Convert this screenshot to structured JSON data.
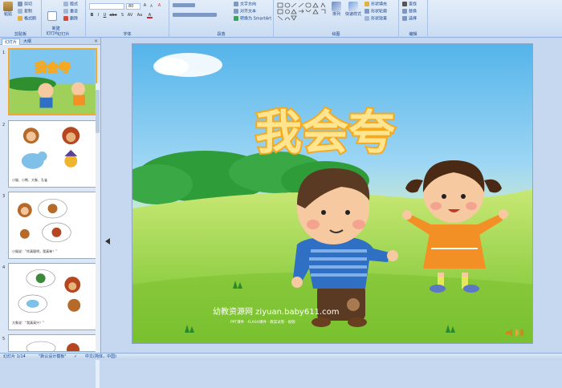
{
  "ribbon": {
    "clipboard": {
      "paste": "粘贴",
      "cut": "剪切",
      "copy": "复制",
      "format_painter": "格式刷",
      "title": "剪贴板"
    },
    "slides": {
      "new_slide": "新建\n幻灯片",
      "layout": "版式",
      "reset": "重设",
      "delete": "删除",
      "title": "幻灯片"
    },
    "font": {
      "font_name": "",
      "font_size": "80",
      "grow": "A",
      "shrink": "A",
      "clear": "A",
      "bold": "B",
      "italic": "I",
      "underline": "U",
      "strike": "abe",
      "shadow": "S",
      "spacing": "AV",
      "case": "Aa",
      "color": "A",
      "title": "字体"
    },
    "paragraph": {
      "text_direction": "文字方向",
      "align_text": "对齐文本",
      "smartart": "转换为 SmartArt",
      "title": "段落"
    },
    "drawing": {
      "arrange": "排列",
      "quick_styles": "快速样式",
      "fill": "形状填充",
      "outline": "形状轮廓",
      "effects": "形状效果",
      "title": "绘图"
    },
    "editing": {
      "find": "查找",
      "replace": "替换",
      "select": "选择",
      "title": "编辑"
    }
  },
  "pane": {
    "tabs": [
      "幻灯片",
      "大纲"
    ],
    "close": "×",
    "thumbnails": [
      {
        "num": "1",
        "title": "我会夸"
      },
      {
        "num": "2",
        "caption": "小猴、小熊、大象、孔雀"
      },
      {
        "num": "3",
        "caption": "小猴说：“你真聪明，我真笨！”"
      },
      {
        "num": "4",
        "caption": "大象说：“我真高兴！”"
      }
    ],
    "partial_num": "5"
  },
  "slide": {
    "title": "我会夸",
    "watermark_main": "幼教资源网  ziyuan.baby611.com",
    "watermark_sub": "PPT课件 · FLASH课件 · 教案试卷 · 视频"
  },
  "status": {
    "slide_count": "幻灯片 1/14",
    "theme": "\"默认设计模板\"",
    "language": "中文(简体，中国)"
  },
  "colors": {
    "ribbon_bg": "#dbe7f6",
    "title_fill": "#ffe590",
    "title_stroke": "#f7a91e",
    "boy_shirt": "#2f6fc4",
    "girl_dress": "#f39025"
  }
}
